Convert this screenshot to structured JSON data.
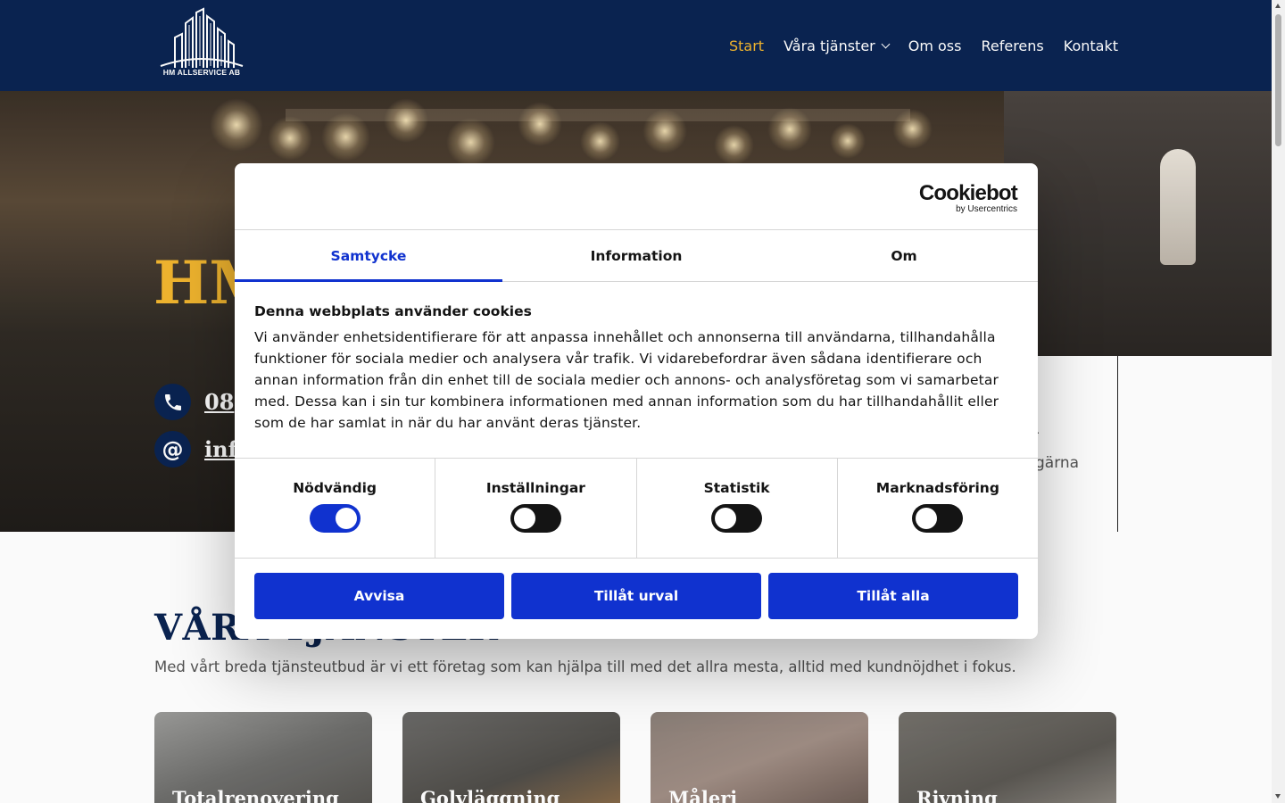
{
  "header": {
    "logo_text": "HM ALLSERVICE AB",
    "nav": [
      {
        "label": "Start",
        "active": true
      },
      {
        "label": "Våra tjänster",
        "has_dropdown": true
      },
      {
        "label": "Om oss"
      },
      {
        "label": "Referens"
      },
      {
        "label": "Kontakt"
      }
    ]
  },
  "hero": {
    "title_visible": "HM",
    "phone_visible": "08",
    "email_visible": "inf",
    "side_fragments": [
      "r",
      "gärna"
    ]
  },
  "services": {
    "title": "VÅRA TJÄNSTER",
    "subtitle": "Med vårt breda tjänsteutbud är vi ett företag som kan hjälpa till med det allra mesta, alltid med kundnöjdhet i fokus.",
    "cards": [
      {
        "label": "Totalrenovering"
      },
      {
        "label": "Golvläggning"
      },
      {
        "label": "Måleri"
      },
      {
        "label": "Rivning"
      }
    ]
  },
  "cookie": {
    "brand": "Cookiebot",
    "brand_sub": "by Usercentrics",
    "tabs": [
      {
        "label": "Samtycke",
        "active": true
      },
      {
        "label": "Information"
      },
      {
        "label": "Om"
      }
    ],
    "title": "Denna webbplats använder cookies",
    "text": "Vi använder enhetsidentifierare för att anpassa innehållet och annonserna till användarna, tillhandahålla funktioner för sociala medier och analysera vår trafik. Vi vidarebefordrar även sådana identifierare och annan information från din enhet till de sociala medier och annons- och analysföretag som vi samarbetar med. Dessa kan i sin tur kombinera informationen med annan information som du har tillhandahållit eller som de har samlat in när du har använt deras tjänster.",
    "toggles": [
      {
        "label": "Nödvändig",
        "on": true
      },
      {
        "label": "Inställningar",
        "on": false
      },
      {
        "label": "Statistik",
        "on": false
      },
      {
        "label": "Marknadsföring",
        "on": false
      }
    ],
    "buttons": {
      "deny": "Avvisa",
      "allow_selection": "Tillåt urval",
      "allow_all": "Tillåt alla"
    }
  },
  "colors": {
    "navy": "#0b2452",
    "gold": "#f2b62f",
    "cookie_blue": "#1032cf"
  }
}
